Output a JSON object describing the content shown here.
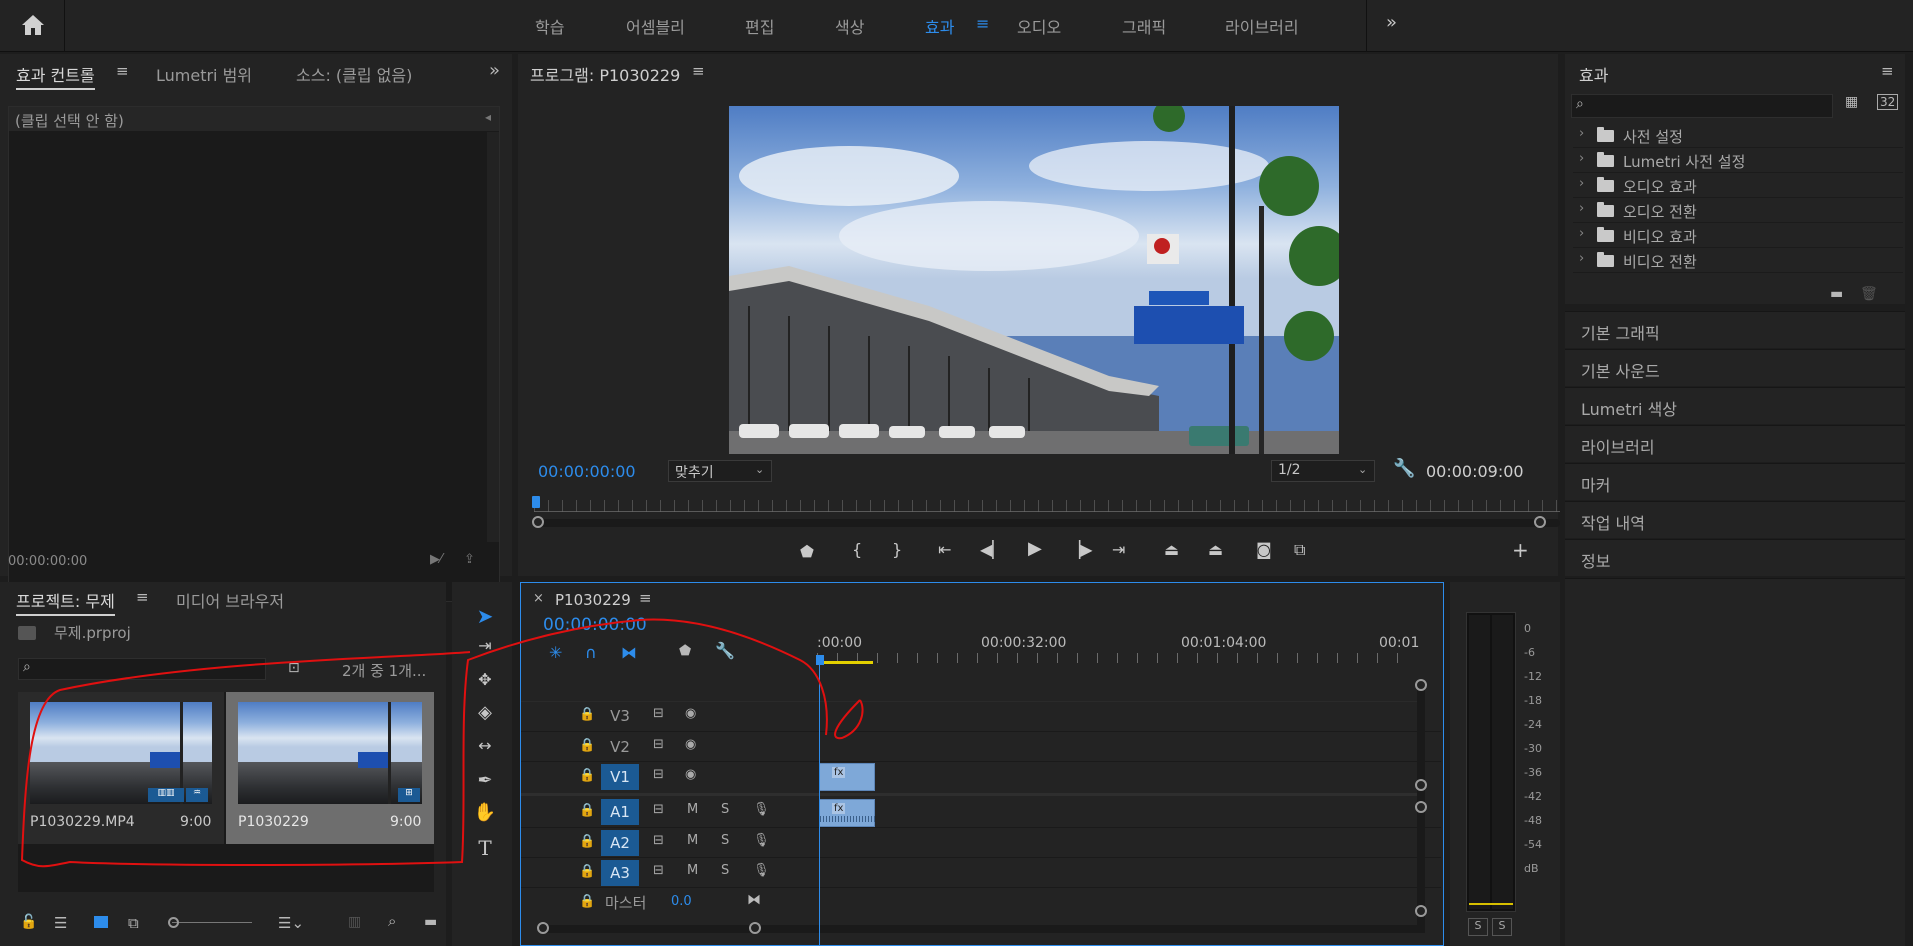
{
  "topbar": {
    "workspaces": [
      "학습",
      "어셈블리",
      "편집",
      "색상",
      "효과",
      "오디오",
      "그래픽",
      "라이브러리"
    ],
    "active_workspace": "효과",
    "more": "»"
  },
  "effect_controls": {
    "tabs": [
      "효과 컨트롤",
      "Lumetri 범위",
      "소스: (클립 없음)"
    ],
    "no_clip": "(클립 선택 안 함)",
    "timecode": "00:00:00:00"
  },
  "program": {
    "title": "프로그램: P1030229",
    "timecode_left": "00:00:00:00",
    "fit": "맞추기",
    "resolution": "1/2",
    "timecode_right": "00:00:09:00"
  },
  "effects_panel": {
    "title": "효과",
    "items": [
      "사전 설정",
      "Lumetri 사전 설정",
      "오디오 효과",
      "오디오 전환",
      "비디오 효과",
      "비디오 전환"
    ],
    "sections": [
      "기본 그래픽",
      "기본 사운드",
      "Lumetri 색상",
      "라이브러리",
      "마커",
      "작업 내역",
      "정보"
    ]
  },
  "project": {
    "tabs": [
      "프로젝트: 무제",
      "미디어 브라우저"
    ],
    "file": "무제.prproj",
    "count": "2개 중 1개...",
    "items": [
      {
        "name": "P1030229.MP4",
        "duration": "9:00"
      },
      {
        "name": "P1030229",
        "duration": "9:00"
      }
    ]
  },
  "timeline": {
    "title": "P1030229",
    "timecode": "00:00:00:00",
    "ruler": [
      ":00:00",
      "00:00:32:00",
      "00:01:04:00",
      "00:01"
    ],
    "video_tracks": [
      "V3",
      "V2",
      "V1"
    ],
    "audio_tracks": [
      "A1",
      "A2",
      "A3"
    ],
    "master": "마스터",
    "master_value": "0.0",
    "m_label": "M",
    "s_label": "S",
    "clip_fx": "fx"
  },
  "meter": {
    "scale": [
      "0",
      "-6",
      "-12",
      "-18",
      "-24",
      "-30",
      "-36",
      "-42",
      "-48",
      "-54",
      "dB"
    ],
    "solo": [
      "S",
      "S"
    ]
  },
  "colors": {
    "accent_blue": "#2d8ceb",
    "track_on": "#1b5a94",
    "clip": "#7ea8d8",
    "annotation_red": "#e01010"
  }
}
